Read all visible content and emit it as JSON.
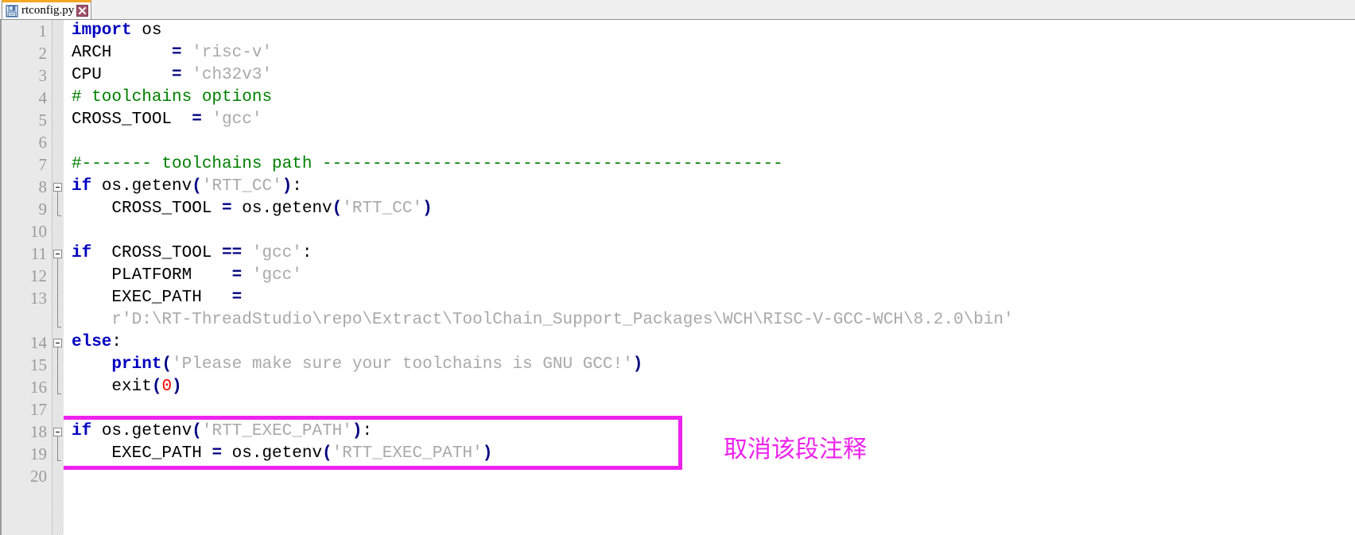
{
  "window": {
    "title": "rtconfig.py"
  },
  "tab": {
    "label": "rtconfig.py",
    "icon": "save-floppy-icon",
    "close_icon": "close-icon",
    "active_accent_color": "#f5a623"
  },
  "editor": {
    "background_color": "#ffffff",
    "gutter_background_color": "#e9e9e9",
    "line_number_color": "#9b9b9b",
    "syntax_colors": {
      "keyword": "#0000c0",
      "operator": "#000080",
      "string": "#a9a9a9",
      "comment": "#008000",
      "number": "#ff0000",
      "plain": "#000000"
    },
    "line_numbers": [
      "1",
      "2",
      "3",
      "4",
      "5",
      "6",
      "7",
      "8",
      "9",
      "10",
      "11",
      "12",
      "13",
      "14",
      "15",
      "16",
      "17",
      "18",
      "19",
      "20"
    ],
    "lines": [
      {
        "num": "1",
        "indent": 0,
        "tokens": [
          {
            "t": "import",
            "c": "kw"
          },
          {
            "t": " os",
            "c": "pl"
          }
        ]
      },
      {
        "num": "2",
        "indent": 0,
        "tokens": [
          {
            "t": "ARCH      ",
            "c": "pl"
          },
          {
            "t": "=",
            "c": "op"
          },
          {
            "t": " ",
            "c": "pl"
          },
          {
            "t": "'risc-v'",
            "c": "str"
          }
        ]
      },
      {
        "num": "3",
        "indent": 0,
        "tokens": [
          {
            "t": "CPU       ",
            "c": "pl"
          },
          {
            "t": "=",
            "c": "op"
          },
          {
            "t": " ",
            "c": "pl"
          },
          {
            "t": "'ch32v3'",
            "c": "str"
          }
        ]
      },
      {
        "num": "4",
        "indent": 0,
        "tokens": [
          {
            "t": "# toolchains options",
            "c": "cmt"
          }
        ]
      },
      {
        "num": "5",
        "indent": 0,
        "tokens": [
          {
            "t": "CROSS_TOOL  ",
            "c": "pl"
          },
          {
            "t": "=",
            "c": "op"
          },
          {
            "t": " ",
            "c": "pl"
          },
          {
            "t": "'gcc'",
            "c": "str"
          }
        ]
      },
      {
        "num": "6",
        "indent": 0,
        "tokens": []
      },
      {
        "num": "7",
        "indent": 0,
        "tokens": [
          {
            "t": "#------- toolchains path ----------------------------------------------",
            "c": "cmt"
          }
        ]
      },
      {
        "num": "8",
        "indent": 0,
        "tokens": [
          {
            "t": "if",
            "c": "kw"
          },
          {
            "t": " os.getenv",
            "c": "pl"
          },
          {
            "t": "(",
            "c": "op"
          },
          {
            "t": "'RTT_CC'",
            "c": "str"
          },
          {
            "t": ")",
            "c": "op"
          },
          {
            "t": ":",
            "c": "pl"
          }
        ]
      },
      {
        "num": "9",
        "indent": 0,
        "tokens": [
          {
            "t": "    CROSS_TOOL ",
            "c": "pl"
          },
          {
            "t": "=",
            "c": "op"
          },
          {
            "t": " os.getenv",
            "c": "pl"
          },
          {
            "t": "(",
            "c": "op"
          },
          {
            "t": "'RTT_CC'",
            "c": "str"
          },
          {
            "t": ")",
            "c": "op"
          }
        ]
      },
      {
        "num": "10",
        "indent": 0,
        "tokens": []
      },
      {
        "num": "11",
        "indent": 0,
        "tokens": [
          {
            "t": "if",
            "c": "kw"
          },
          {
            "t": "  CROSS_TOOL ",
            "c": "pl"
          },
          {
            "t": "==",
            "c": "op"
          },
          {
            "t": " ",
            "c": "pl"
          },
          {
            "t": "'gcc'",
            "c": "str"
          },
          {
            "t": ":",
            "c": "pl"
          }
        ]
      },
      {
        "num": "12",
        "indent": 0,
        "tokens": [
          {
            "t": "    PLATFORM    ",
            "c": "pl"
          },
          {
            "t": "=",
            "c": "op"
          },
          {
            "t": " ",
            "c": "pl"
          },
          {
            "t": "'gcc'",
            "c": "str"
          }
        ]
      },
      {
        "num": "13",
        "indent": 0,
        "tokens": [
          {
            "t": "    EXEC_PATH   ",
            "c": "pl"
          },
          {
            "t": "=",
            "c": "op"
          }
        ]
      },
      {
        "num": "",
        "indent": 0,
        "wrapped": true,
        "tokens": [
          {
            "t": "    r'D:\\RT-ThreadStudio\\repo\\Extract\\ToolChain_Support_Packages\\WCH\\RISC-V-GCC-WCH\\8.2.0\\bin'",
            "c": "str"
          }
        ]
      },
      {
        "num": "14",
        "indent": 0,
        "tokens": [
          {
            "t": "else",
            "c": "kw"
          },
          {
            "t": ":",
            "c": "pl"
          }
        ]
      },
      {
        "num": "15",
        "indent": 0,
        "tokens": [
          {
            "t": "    ",
            "c": "pl"
          },
          {
            "t": "print",
            "c": "kw"
          },
          {
            "t": "(",
            "c": "op"
          },
          {
            "t": "'Please make sure your toolchains is GNU GCC!'",
            "c": "str"
          },
          {
            "t": ")",
            "c": "op"
          }
        ]
      },
      {
        "num": "16",
        "indent": 0,
        "tokens": [
          {
            "t": "    exit",
            "c": "pl"
          },
          {
            "t": "(",
            "c": "op"
          },
          {
            "t": "0",
            "c": "num"
          },
          {
            "t": ")",
            "c": "op"
          }
        ]
      },
      {
        "num": "17",
        "indent": 0,
        "tokens": []
      },
      {
        "num": "18",
        "indent": 0,
        "tokens": [
          {
            "t": "if",
            "c": "kw"
          },
          {
            "t": " os.getenv",
            "c": "pl"
          },
          {
            "t": "(",
            "c": "op"
          },
          {
            "t": "'RTT_EXEC_PATH'",
            "c": "str"
          },
          {
            "t": ")",
            "c": "op"
          },
          {
            "t": ":",
            "c": "pl"
          }
        ]
      },
      {
        "num": "19",
        "indent": 0,
        "tokens": [
          {
            "t": "    EXEC_PATH ",
            "c": "pl"
          },
          {
            "t": "=",
            "c": "op"
          },
          {
            "t": " os.getenv",
            "c": "pl"
          },
          {
            "t": "(",
            "c": "op"
          },
          {
            "t": "'RTT_EXEC_PATH'",
            "c": "str"
          },
          {
            "t": ")",
            "c": "op"
          }
        ]
      },
      {
        "num": "20",
        "indent": 0,
        "tokens": []
      }
    ],
    "fold_markers": [
      {
        "line": "8",
        "type": "collapse-box"
      },
      {
        "line": "11",
        "type": "collapse-box"
      },
      {
        "line": "14",
        "type": "collapse-box"
      },
      {
        "line": "18",
        "type": "collapse-box"
      }
    ]
  },
  "annotation": {
    "text": "取消该段注释",
    "color": "#ee22ee",
    "highlight_color": "#ee22ee"
  }
}
